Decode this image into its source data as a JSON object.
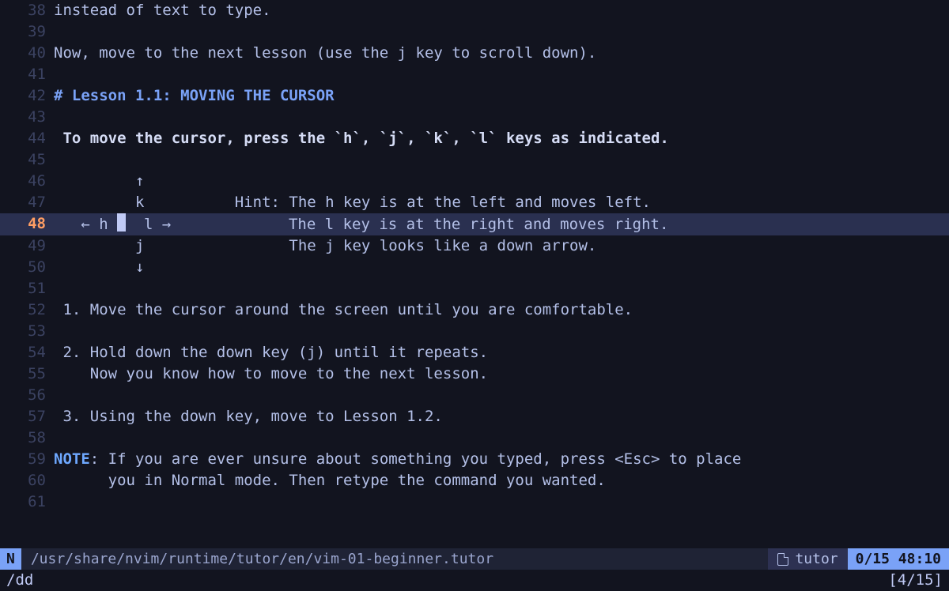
{
  "cursor_line_number": 48,
  "lines": [
    {
      "n": 38,
      "segs": [
        {
          "t": "instead of text to type."
        }
      ]
    },
    {
      "n": 39,
      "segs": []
    },
    {
      "n": 40,
      "segs": [
        {
          "t": "Now, move to the next lesson (use the j key to scroll down)."
        }
      ]
    },
    {
      "n": 41,
      "segs": []
    },
    {
      "n": 42,
      "segs": [
        {
          "t": "# Lesson 1.1: MOVING THE CURSOR",
          "cls": "heading"
        }
      ]
    },
    {
      "n": 43,
      "segs": []
    },
    {
      "n": 44,
      "segs": [
        {
          "t": " To move the cursor, press the `h`, `j`, `k`, `l` keys as indicated.",
          "cls": "bold"
        }
      ]
    },
    {
      "n": 45,
      "segs": []
    },
    {
      "n": 46,
      "segs": [
        {
          "t": "         ↑"
        }
      ]
    },
    {
      "n": 47,
      "segs": [
        {
          "t": "         k          Hint: The h key is at the left and moves left."
        }
      ]
    },
    {
      "n": 48,
      "cursorline": true,
      "segs": [
        {
          "t": "   ← h "
        },
        {
          "cursor": true
        },
        {
          "t": "  l →             The l key is at the right and moves right."
        }
      ]
    },
    {
      "n": 49,
      "segs": [
        {
          "t": "         j                The j key looks like a down arrow."
        }
      ]
    },
    {
      "n": 50,
      "segs": [
        {
          "t": "         ↓"
        }
      ]
    },
    {
      "n": 51,
      "segs": []
    },
    {
      "n": 52,
      "segs": [
        {
          "t": " 1. Move the cursor around the screen until you are comfortable."
        }
      ]
    },
    {
      "n": 53,
      "segs": []
    },
    {
      "n": 54,
      "segs": [
        {
          "t": " 2. Hold down the down key (j) until it repeats."
        }
      ]
    },
    {
      "n": 55,
      "segs": [
        {
          "t": "    Now you know how to move to the next lesson."
        }
      ]
    },
    {
      "n": 56,
      "segs": []
    },
    {
      "n": 57,
      "segs": [
        {
          "t": " 3. Using the down key, move to Lesson 1.2."
        }
      ]
    },
    {
      "n": 58,
      "segs": []
    },
    {
      "n": 59,
      "segs": [
        {
          "t": "NOTE",
          "cls": "note"
        },
        {
          "t": ": If you are ever unsure about something you typed, press <Esc> to place"
        }
      ]
    },
    {
      "n": 60,
      "segs": [
        {
          "t": "      you in Normal mode. Then retype the command you wanted."
        }
      ]
    },
    {
      "n": 61,
      "segs": []
    }
  ],
  "status": {
    "mode": "N",
    "filepath": "/usr/share/nvim/runtime/tutor/en/vim-01-beginner.tutor",
    "filetype": "tutor",
    "position": "0/15 48:10"
  },
  "cmdline": {
    "command": "/dd",
    "search_count": "[4/15]"
  }
}
